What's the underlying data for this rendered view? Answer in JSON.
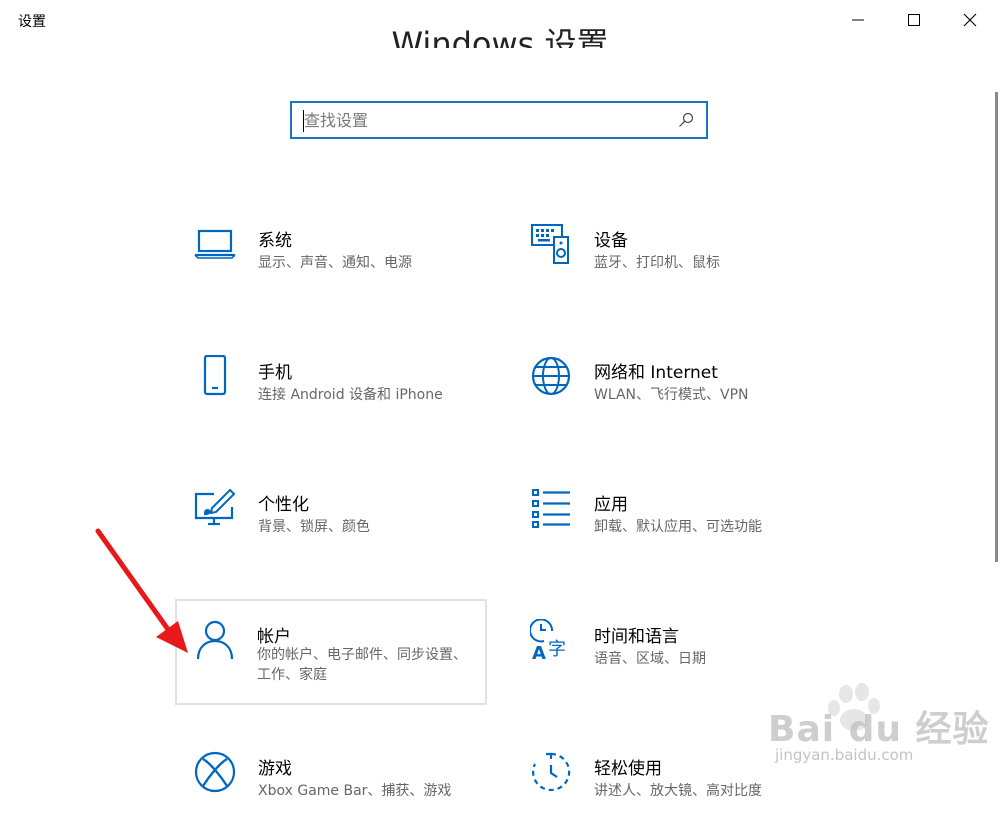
{
  "window": {
    "title": "设置"
  },
  "heading": "Windows 设置",
  "search": {
    "placeholder": "查找设置"
  },
  "tiles": [
    {
      "title": "系统",
      "desc": "显示、声音、通知、电源",
      "icon": "laptop-icon"
    },
    {
      "title": "设备",
      "desc": "蓝牙、打印机、鼠标",
      "icon": "devices-icon"
    },
    {
      "title": "手机",
      "desc": "连接 Android 设备和 iPhone",
      "icon": "phone-icon"
    },
    {
      "title": "网络和 Internet",
      "desc": "WLAN、飞行模式、VPN",
      "icon": "globe-icon"
    },
    {
      "title": "个性化",
      "desc": "背景、锁屏、颜色",
      "icon": "personalization-icon"
    },
    {
      "title": "应用",
      "desc": "卸载、默认应用、可选功能",
      "icon": "apps-list-icon"
    },
    {
      "title": "帐户",
      "desc": "你的帐户、电子邮件、同步设置、工作、家庭",
      "icon": "person-icon"
    },
    {
      "title": "时间和语言",
      "desc": "语音、区域、日期",
      "icon": "time-language-icon"
    },
    {
      "title": "游戏",
      "desc": "Xbox Game Bar、捕获、游戏",
      "icon": "xbox-icon"
    },
    {
      "title": "轻松使用",
      "desc": "讲述人、放大镜、高对比度",
      "icon": "ease-of-access-icon"
    }
  ],
  "watermark": {
    "brand": "Bai du 经验",
    "url": "jingyan.baidu.com"
  },
  "colors": {
    "accent": "#0067c0",
    "search_border": "#1a73c8",
    "annotation_arrow": "#e8191b"
  }
}
